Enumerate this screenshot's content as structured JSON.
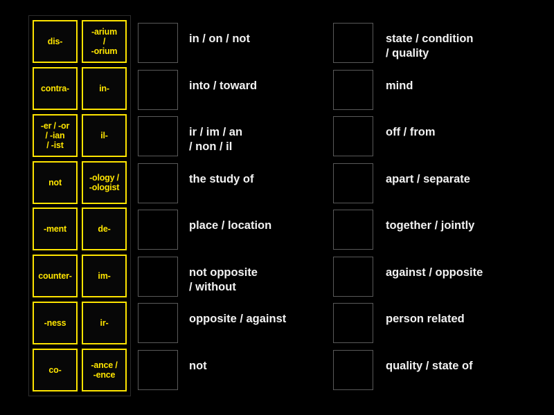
{
  "tiles": [
    {
      "left": "dis-",
      "right": "-arium\n/\n-orium"
    },
    {
      "left": "contra-",
      "right": "in-"
    },
    {
      "left": "-er / -or\n/ -ian\n/ -ist",
      "right": "il-"
    },
    {
      "left": "not",
      "right": "-ology /\n-ologist"
    },
    {
      "left": "-ment",
      "right": "de-"
    },
    {
      "left": "counter-",
      "right": "im-"
    },
    {
      "left": "-ness",
      "right": "ir-"
    },
    {
      "left": "co-",
      "right": "-ance /\n-ence"
    }
  ],
  "middle_column": {
    "answers": [
      {
        "label": "in / on / not"
      },
      {
        "label": "into / toward"
      },
      {
        "label": "ir / im / an\n/ non / il"
      },
      {
        "label": "the study of"
      },
      {
        "label": "place / location"
      },
      {
        "label": "not opposite\n/ without"
      },
      {
        "label": "opposite / against"
      },
      {
        "label": "not"
      }
    ]
  },
  "right_column": {
    "answers": [
      {
        "label": "state / condition\n/ quality"
      },
      {
        "label": "mind"
      },
      {
        "label": "off / from"
      },
      {
        "label": "apart / separate"
      },
      {
        "label": "together / jointly"
      },
      {
        "label": "against / opposite"
      },
      {
        "label": "person related"
      },
      {
        "label": "quality / state of"
      }
    ]
  },
  "colors": {
    "background": "#000000",
    "tile_border": "#ffe500",
    "tile_text": "#ffe500",
    "answer_text": "#f2f2f2",
    "drop_box_border": "#5a5a5a",
    "panel_border": "#2c2c2c"
  }
}
